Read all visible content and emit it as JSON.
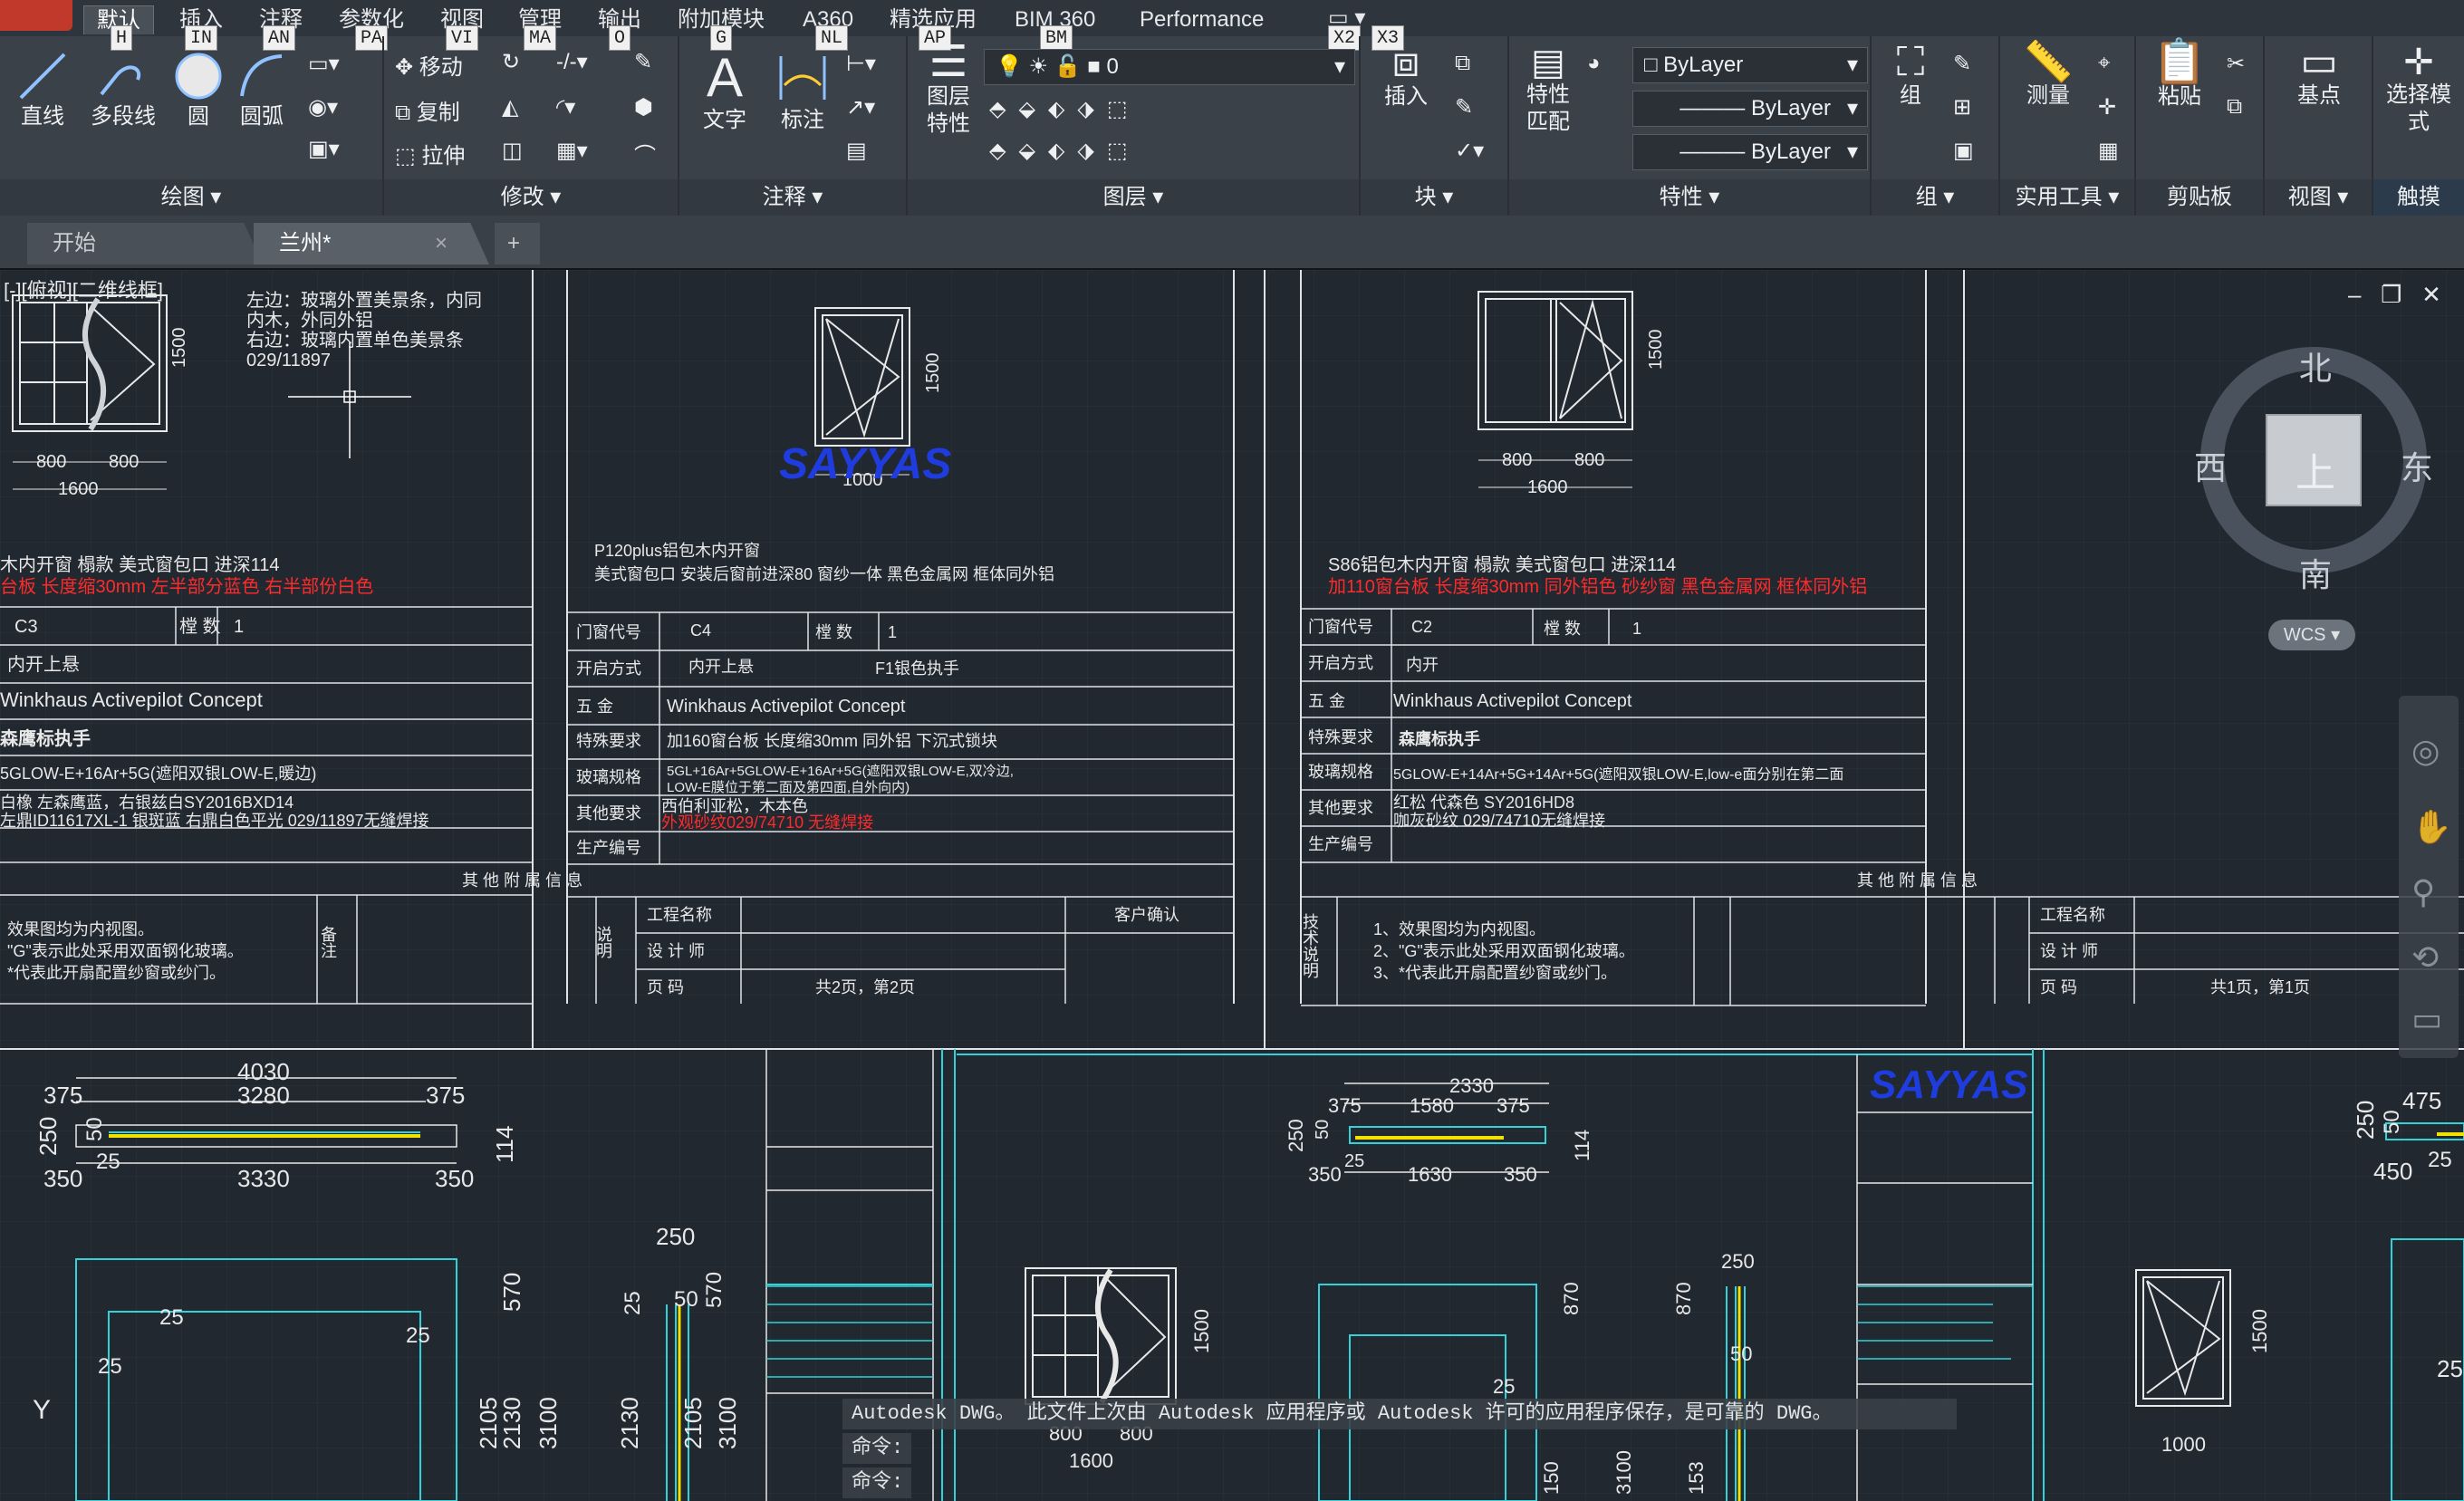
{
  "ribbon": {
    "tabs": [
      "默认",
      "插入",
      "注释",
      "参数化",
      "视图",
      "管理",
      "输出",
      "附加模块",
      "A360",
      "精选应用",
      "BIM 360",
      "Performance"
    ],
    "keytips": {
      "insert": "IN",
      "annotate": "AN",
      "parametric": "PA",
      "view": "VI",
      "manage": "MA",
      "output": "O",
      "addins": "G",
      "a360": "NL",
      "featured": "AP",
      "bim360": "BM",
      "perf1": "X2",
      "perf2": "X3",
      "home": "H"
    },
    "panels": {
      "draw": {
        "title": "绘图",
        "tools": [
          "直线",
          "多段线",
          "圆",
          "圆弧"
        ]
      },
      "modify": {
        "title": "修改",
        "tools": [
          "移动",
          "复制",
          "拉伸"
        ]
      },
      "annotation": {
        "title": "注释",
        "tools": [
          "文字",
          "标注"
        ]
      },
      "layers": {
        "title": "图层",
        "tools": [
          "图层特性"
        ],
        "current_layer": "0"
      },
      "block": {
        "title": "块",
        "tools": [
          "插入"
        ]
      },
      "properties": {
        "title": "特性",
        "tools": [
          "特性匹配"
        ],
        "color": "ByLayer",
        "linetype": "ByLayer",
        "lineweight": "ByLayer"
      },
      "groups": {
        "title": "组",
        "tools": [
          "组"
        ]
      },
      "utilities": {
        "title": "实用工具",
        "tools": [
          "测量"
        ]
      },
      "clipboard": {
        "title": "剪贴板",
        "tools": [
          "粘贴"
        ]
      },
      "view": {
        "title": "视图",
        "tools": [
          "基点"
        ]
      },
      "touch": {
        "title": "触摸",
        "tools": [
          "选择模式"
        ]
      }
    }
  },
  "doc_tabs": [
    "开始",
    "兰州*"
  ],
  "viewport_label": "[-][俯视][二维线框]",
  "viewcube": {
    "north": "北",
    "south": "南",
    "east": "东",
    "west": "西",
    "top": "上",
    "wcs": "WCS"
  },
  "drawing": {
    "sheet1": {
      "notes": [
        "左边：玻璃外置美景条，内同",
        "内木，外同外铝",
        "右边：玻璃内置单色美景条",
        "029/11897"
      ],
      "dims": {
        "w1": "800",
        "w2": "800",
        "total": "1600",
        "h": "1500"
      },
      "title_black": "木内开窗 榻款     美式窗包口  进深114",
      "title_red": "台板 长度缩30mm 左半部分蓝色  右半部份白色",
      "rows": [
        {
          "k": "C3",
          "k2": "樘  数",
          "v": "1"
        },
        {
          "k": "内开上悬"
        },
        {
          "k": "Winkhaus Activepilot Concept"
        },
        {
          "k": "森鹰标执手"
        },
        {
          "k": "5GLOW-E+16Ar+5G(遮阳双银LOW-E,暖边)"
        },
        {
          "k": "白橡   左森鹰蓝，右银兹白SY2016BXD14"
        },
        {
          "k": "左鼎ID11617XL-1 银斑蓝  右鼎白色平光 029/11897无缝焊接"
        }
      ],
      "notes2": [
        "效果图均为内视图。",
        "\"G\"表示此处采用双面钢化玻璃。",
        "*代表此开扇配置纱窗或纱门。"
      ],
      "beizhu": "备注"
    },
    "sheet2": {
      "dims": {
        "w": "1000",
        "h": "1500"
      },
      "title1": "P120plus铝包木内开窗",
      "title2": "美式窗包口  安装后窗前进深80  窗纱一体  黑色金属网  框体同外铝",
      "labels": [
        "门窗代号",
        "开启方式",
        "五   金",
        "特殊要求",
        "玻璃规格",
        "其他要求",
        "生产编号"
      ],
      "values": [
        "C4",
        "内开上悬",
        "Winkhaus Activepilot Concept",
        "加160窗台板    长度缩30mm  同外铝  下沉式锁块",
        "5GL+16Ar+5GLOW-E+16Ar+5G(遮阳双银LOW-E,双冷边,",
        "LOW-E膜位于第二面及第四面,自外向内)",
        "西伯利亚松，木本色",
        "外观砂纹029/74710 无缝焊接"
      ],
      "count_label": "樘   数",
      "count": "1",
      "handle": "F1银色执手",
      "other_info": "其    他    附    属    信    息",
      "project": "工程名称",
      "designer": "设  计  师",
      "page": "页     码",
      "page_val": "共2页，第2页",
      "client": "客户确认",
      "desc": "说明"
    },
    "sheet3": {
      "dims": {
        "w1": "800",
        "w2": "800",
        "total": "1600",
        "h": "1500"
      },
      "title_black": "S86铝包木内开窗 榻款     美式窗包口  进深114",
      "title_red": "加110窗台板 长度缩30mm  同外铝色  砂纱窗  黑色金属网  框体同外铝",
      "labels": [
        "门窗代号",
        "开启方式",
        "五    金",
        "特殊要求",
        "玻璃规格",
        "其他要求",
        "生产编号"
      ],
      "values": [
        "C2",
        "内开",
        "Winkhaus Activepilot Concept",
        "森鹰标执手",
        "5GLOW-E+14Ar+5G+14Ar+5G(遮阳双银LOW-E,low-e面分别在第二面",
        "红松   代森色   SY2016HD8",
        "咖灰砂纹 029/74710无缝焊接"
      ],
      "count_label": "樘   数",
      "count": "1",
      "other_info": "其    他    附    属    信    息",
      "notes": [
        "1、效果图均为内视图。",
        "2、\"G\"表示此处采用双面钢化玻璃。",
        "3、*代表此开扇配置纱窗或纱门。"
      ],
      "tech": "技术说明",
      "project": "工程名称",
      "designer": "设  计  师",
      "page": "页     码",
      "page_val": "共1页，第1页"
    },
    "lower": {
      "d1": {
        "a": "4030",
        "b": "3280",
        "c": "375",
        "d": "375",
        "e": "3330",
        "f": "350",
        "g": "350",
        "h": "250",
        "i": "50",
        "j": "25",
        "k": "114"
      },
      "d2": {
        "a": "2330",
        "b": "1580",
        "c": "375",
        "d": "375",
        "e": "1630",
        "f": "350",
        "g": "350",
        "h": "250",
        "i": "50",
        "j": "25",
        "k": "114"
      },
      "d3": {
        "a": "475",
        "b": "450",
        "c": "250",
        "d": "25",
        "e": "50",
        "f": "25"
      },
      "v": [
        "570",
        "2105",
        "2130",
        "3100",
        "250",
        "25",
        "50",
        "570",
        "2130",
        "2105",
        "3100",
        "25",
        "25",
        "25",
        "25",
        "870",
        "870",
        "250",
        "50",
        "25",
        "1500",
        "800",
        "800",
        "1600",
        "1000",
        "1500",
        "150",
        "3100",
        "153"
      ],
      "logo": "SAYYAS",
      "y": "Y"
    }
  },
  "command": {
    "message": "Autodesk DWG。 此文件上次由 Autodesk 应用程序或 Autodesk 许可的应用程序保存，是可靠的 DWG。",
    "prompt1": "命令:",
    "prompt2": "命令:"
  },
  "colors": {
    "bg": "#212830",
    "ribbon": "#3b4149",
    "cyan": "#33d1d8",
    "red": "#ff2a2a",
    "blue": "#1f3ddf",
    "yellow": "#f1e000",
    "white": "#ffffff"
  }
}
